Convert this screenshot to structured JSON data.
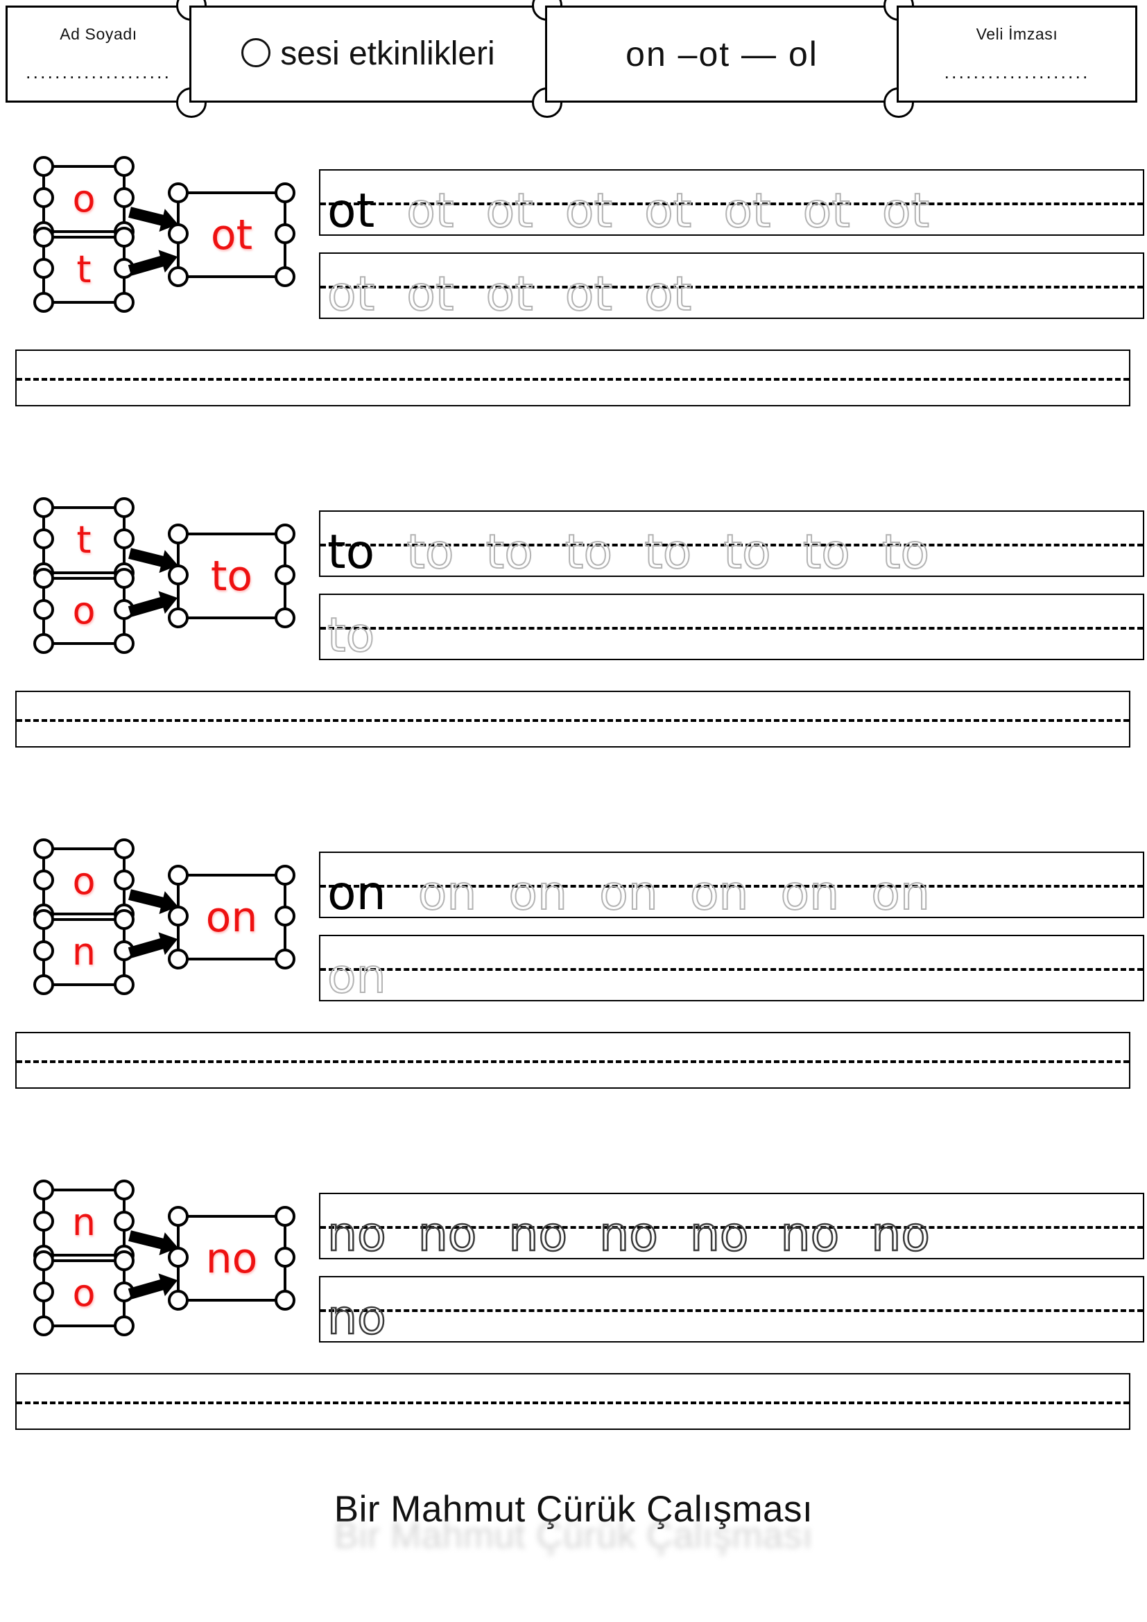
{
  "header": {
    "name_label": "Ad Soyadı",
    "name_dots": "....................",
    "title": "sesi etkinlikleri",
    "title_letter": "O",
    "subtitle": "on –ot — ol",
    "sign_label": "Veli İmzası",
    "sign_dots": "...................."
  },
  "blocks": [
    {
      "letter_top": "o",
      "letter_bottom": "t",
      "syllable": "ot",
      "line1": {
        "solid": "ot",
        "ghost_count": 7,
        "ghost": "ot",
        "style": "light"
      },
      "line2": {
        "solid": "",
        "ghost_count": 5,
        "ghost": "ot",
        "style": "light"
      },
      "practice_line": ""
    },
    {
      "letter_top": "t",
      "letter_bottom": "o",
      "syllable": "to",
      "line1": {
        "solid": "to",
        "ghost_count": 7,
        "ghost": "to",
        "style": "light"
      },
      "line2": {
        "solid": "",
        "ghost_count": 1,
        "ghost": "to",
        "style": "light"
      },
      "practice_line": ""
    },
    {
      "letter_top": "o",
      "letter_bottom": "n",
      "syllable": "on",
      "line1": {
        "solid": "on",
        "ghost_count": 6,
        "ghost": "on",
        "style": "light"
      },
      "line2": {
        "solid": "",
        "ghost_count": 1,
        "ghost": "on",
        "style": "light"
      },
      "practice_line": ""
    },
    {
      "letter_top": "n",
      "letter_bottom": "o",
      "syllable": "no",
      "line1": {
        "solid": "",
        "ghost_count": 7,
        "ghost": "no",
        "style": "dark"
      },
      "line2": {
        "solid": "",
        "ghost_count": 1,
        "ghost": "no",
        "style": "dark"
      },
      "practice_line": ""
    }
  ],
  "footer": {
    "credit": "Bir Mahmut Çürük Çalışması"
  },
  "colors": {
    "letter_red": "#ee1111",
    "ink": "#111111",
    "ghost_gray": "#b3b3b3",
    "ghost_dark": "#3a3a3a"
  }
}
